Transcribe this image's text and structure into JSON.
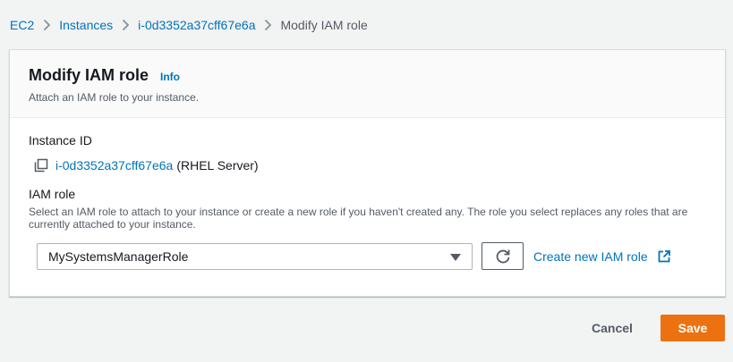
{
  "breadcrumb": {
    "items": [
      "EC2",
      "Instances",
      "i-0d3352a37cff67e6a"
    ],
    "current": "Modify IAM role"
  },
  "panel": {
    "title": "Modify IAM role",
    "info_label": "Info",
    "description": "Attach an IAM role to your instance."
  },
  "instance": {
    "label": "Instance ID",
    "id": "i-0d3352a37cff67e6a",
    "name": "(RHEL Server)"
  },
  "iam_role": {
    "label": "IAM role",
    "description": "Select an IAM role to attach to your instance or create a new role if you haven't created any. The role you select replaces any roles that are currently attached to your instance.",
    "selected_value": "MySystemsManagerRole",
    "create_link": "Create new IAM role"
  },
  "actions": {
    "cancel_label": "Cancel",
    "save_label": "Save"
  },
  "icons": {
    "separator": "chevron-right-icon",
    "copy": "copy-icon",
    "dropdown": "caret-down-icon",
    "refresh": "refresh-icon",
    "external": "external-link-icon"
  },
  "colors": {
    "link": "#0073bb",
    "primary_button": "#ec7211",
    "text": "#16191f",
    "secondary_text": "#545b64",
    "background": "#f2f3f3"
  }
}
